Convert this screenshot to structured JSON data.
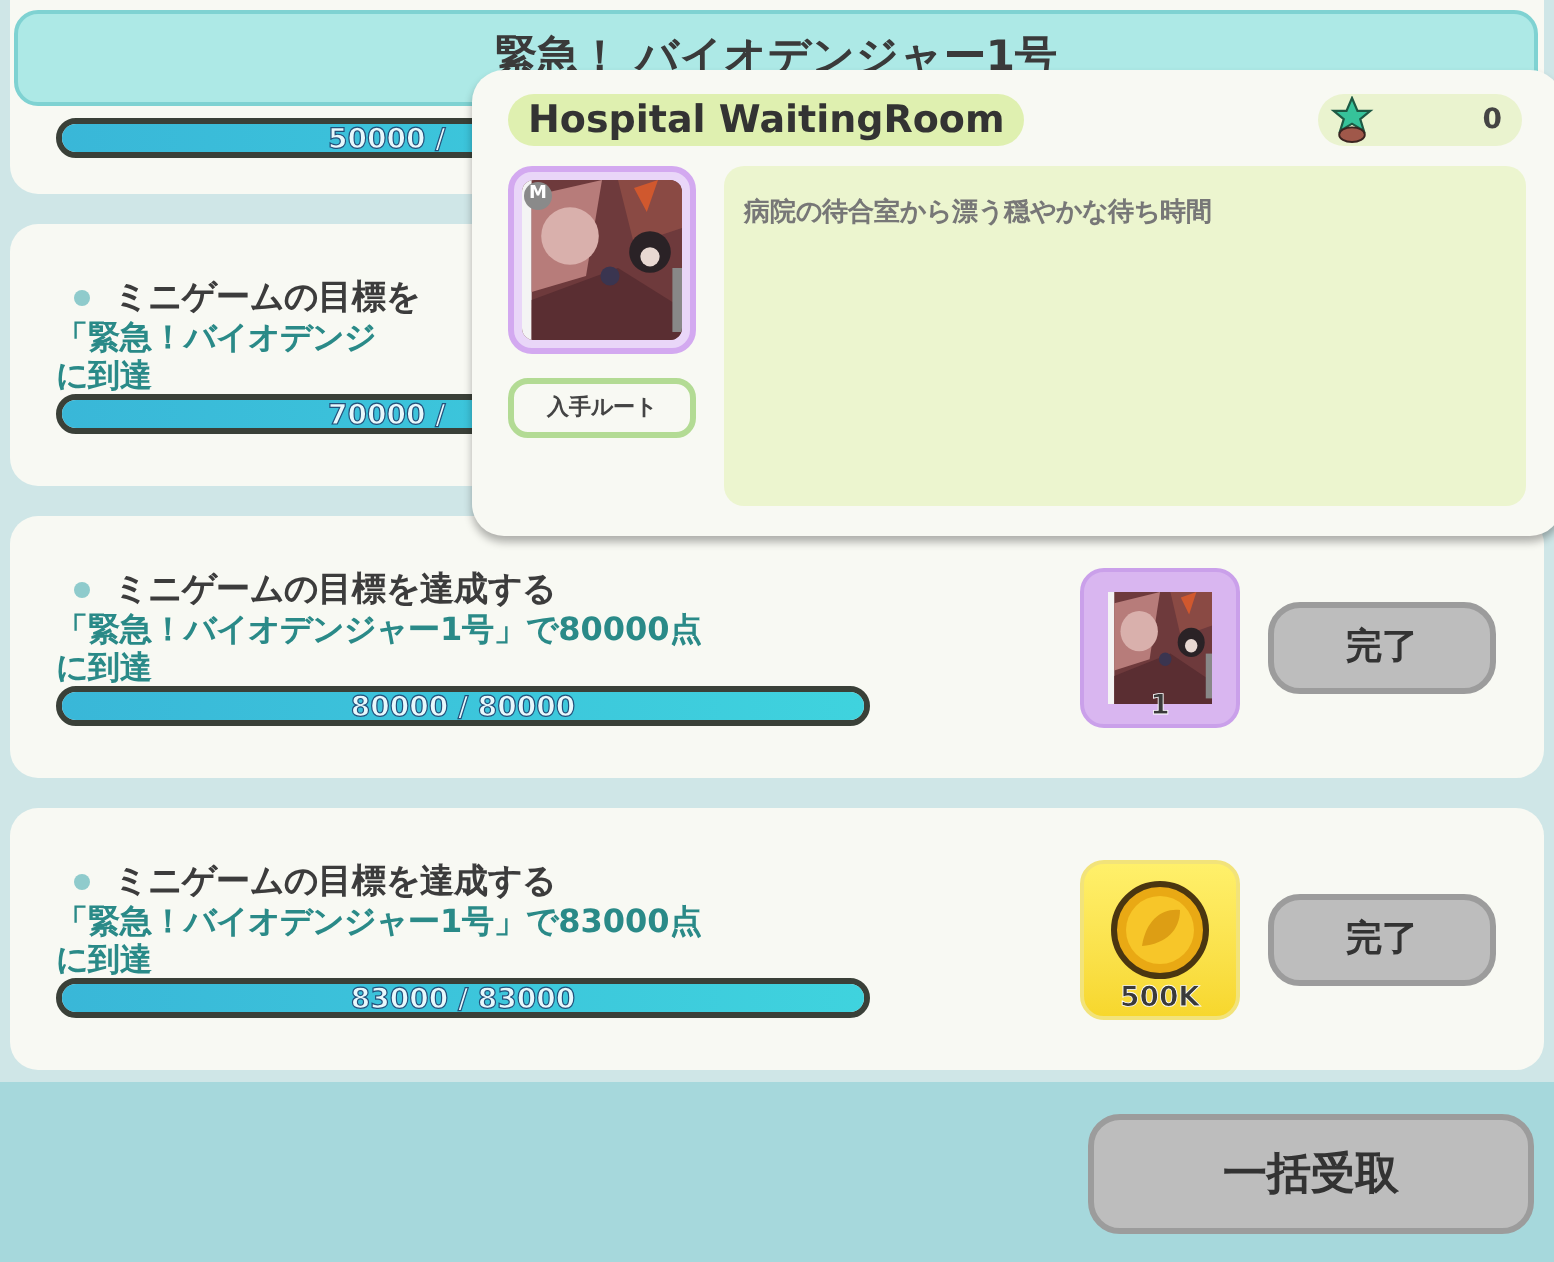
{
  "header": {
    "title": "緊急！ バイオデンジャー1号"
  },
  "missions": [
    {
      "progress": {
        "level": 1,
        "reading": "50000 /"
      }
    },
    {
      "title": "ミニゲームの目標を",
      "detail": "「緊急！バイオデンジ",
      "detail_2": "に到達",
      "progress": {
        "level": 1,
        "reading": "70000 /"
      }
    },
    {
      "title": "ミニゲームの目標を達成する",
      "detail": "「緊急！バイオデンジャー1号」で80000点",
      "detail_2": "に到達",
      "progress": {
        "level": 1,
        "reading": "80000 / 80000"
      },
      "reward": {
        "kind": "picture",
        "count": "1"
      },
      "button": "完了"
    },
    {
      "title": "ミニゲームの目標を達成する",
      "detail": "「緊急！バイオデンジャー1号」で83000点",
      "detail_2": "に到達",
      "progress": {
        "level": 1,
        "reading": "83000 / 83000"
      },
      "reward": {
        "kind": "coin",
        "count": "500K"
      },
      "button": "完了"
    }
  ],
  "claim_all_button": "一括受取",
  "popup": {
    "title": "Hospital WaitingRoom",
    "count": "0",
    "badge": "M",
    "route_button": "入手ルート",
    "description": "病院の待合室から漂う穏やかな待ち時間"
  }
}
